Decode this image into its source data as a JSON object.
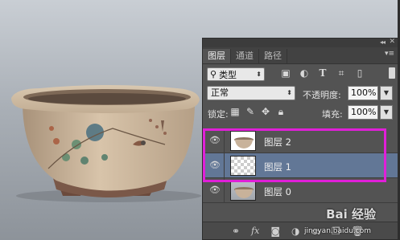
{
  "panel": {
    "tabs": [
      {
        "label": "图层",
        "active": true
      },
      {
        "label": "通道",
        "active": false
      },
      {
        "label": "路径",
        "active": false
      }
    ],
    "filter": {
      "icon": "search-icon",
      "label": "类型"
    },
    "filter_icons": [
      "image-icon",
      "circle-half-icon",
      "text-T-icon",
      "transform-icon",
      "smart-object-icon"
    ],
    "blend_mode": "正常",
    "opacity_label": "不透明度:",
    "opacity_value": "100%",
    "lock_label": "锁定:",
    "fill_label": "填充:",
    "fill_value": "100%",
    "layers": [
      {
        "name": "图层 2",
        "thumbnail": "pot-image",
        "selected": false,
        "visible": true
      },
      {
        "name": "图层 1",
        "thumbnail": "transparent",
        "selected": true,
        "visible": true
      },
      {
        "name": "图层 0",
        "thumbnail": "pot-image",
        "selected": false,
        "visible": true
      }
    ],
    "bottom_icons": [
      "link-icon",
      "fx-icon",
      "mask-icon",
      "adjustment-icon",
      "folder-icon",
      "new-layer-icon",
      "trash-icon"
    ]
  },
  "highlight_color": "#e01fd8",
  "selected_layer_color": "#627796",
  "watermark": {
    "text": "Bai 经验",
    "sub": "jingyan.baidu.com"
  }
}
